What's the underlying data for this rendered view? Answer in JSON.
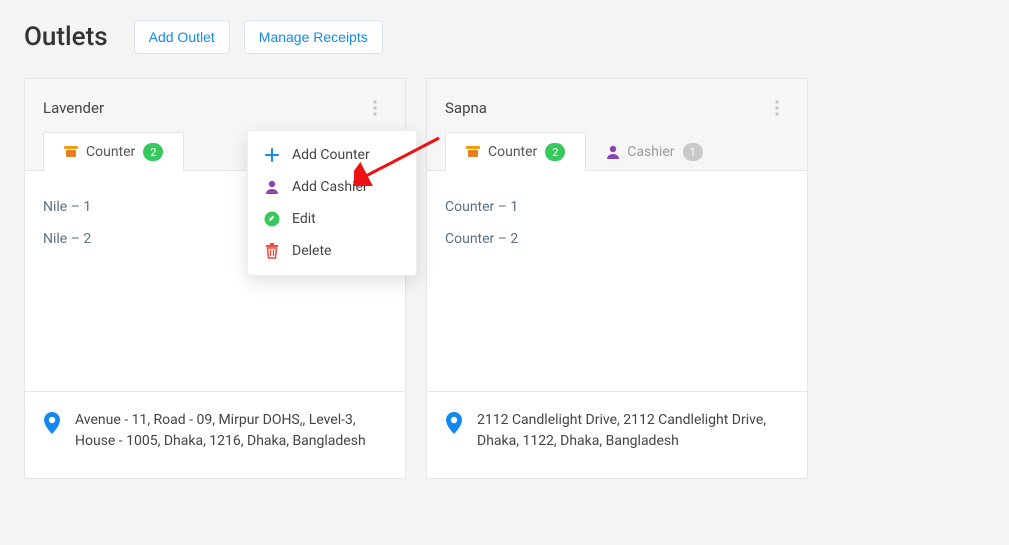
{
  "page": {
    "title": "Outlets"
  },
  "header_buttons": {
    "add_outlet": "Add Outlet",
    "manage_receipts": "Manage Receipts"
  },
  "menu": {
    "add_counter": "Add Counter",
    "add_cashier": "Add Cashier",
    "edit": "Edit",
    "delete": "Delete"
  },
  "outlets": [
    {
      "name": "Lavender",
      "tabs": {
        "counter_label": "Counter",
        "counter_count": "2"
      },
      "items": [
        "Nile  – 1",
        "Nile  – 2"
      ],
      "address": "Avenue - 11, Road - 09, Mirpur DOHS,, Level-3, House - 1005, Dhaka, 1216, Dhaka, Bangladesh"
    },
    {
      "name": "Sapna",
      "tabs": {
        "counter_label": "Counter",
        "counter_count": "2",
        "cashier_label": "Cashier",
        "cashier_count": "1"
      },
      "items": [
        "Counter  – 1",
        "Counter  – 2"
      ],
      "address": "2112 Candlelight Drive, 2112 Candlelight Drive, Dhaka, 1122, Dhaka, Bangladesh"
    }
  ]
}
